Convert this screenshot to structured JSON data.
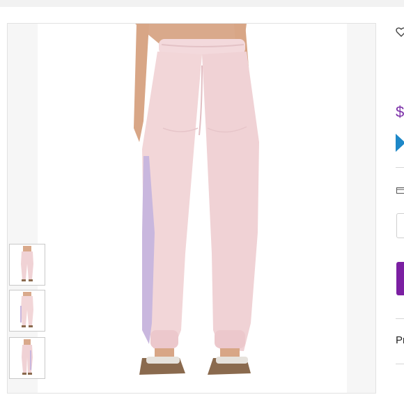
{
  "product": {
    "price_fragment": "$",
    "details_fragment": "Pr"
  },
  "colors": {
    "accent_purple": "#7b1fa2",
    "price_purple": "#7b2fa8",
    "promo_blue": "#1e88c8",
    "pant_pink": "#f2d6d8",
    "side_stripe_lavender": "#c9b7de"
  },
  "gallery": {
    "thumbnails": [
      {
        "view": "front"
      },
      {
        "view": "back"
      },
      {
        "view": "side"
      }
    ]
  },
  "icons": {
    "favorite": "heart-icon",
    "delivery": "calendar-icon",
    "promo": "promo-badge-icon"
  }
}
